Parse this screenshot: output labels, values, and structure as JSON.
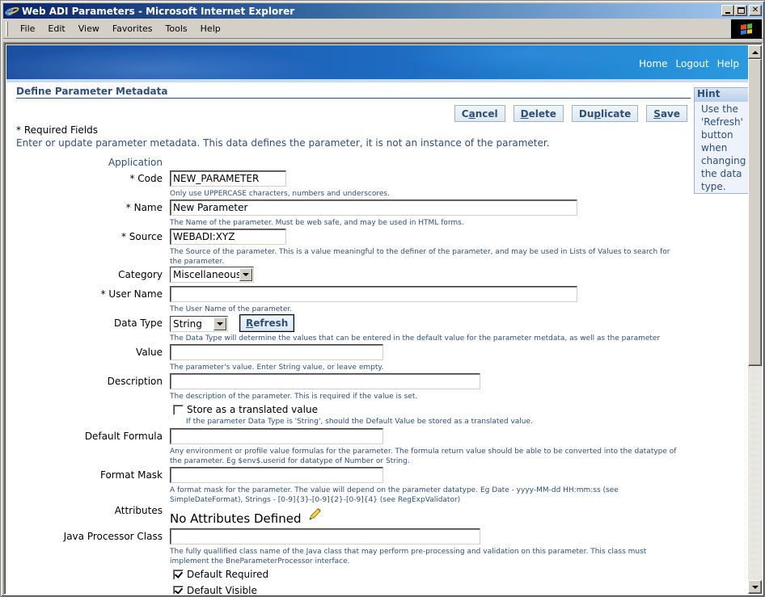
{
  "window": {
    "title": "Web ADI Parameters - Microsoft Internet Explorer",
    "controls": [
      "minimize",
      "maximize",
      "close"
    ]
  },
  "menu": {
    "items": [
      "File",
      "Edit",
      "View",
      "Favorites",
      "Tools",
      "Help"
    ]
  },
  "global_links": [
    "Home",
    "Logout",
    "Help"
  ],
  "page": {
    "title": "Define Parameter Metadata",
    "required_note": "* Required Fields",
    "intro": "Enter or update parameter metadata. This data defines the parameter, it is not an instance of the parameter."
  },
  "actions": {
    "cancel": {
      "pre": "C",
      "key": "a",
      "post": "ncel"
    },
    "delete": {
      "pre": "",
      "key": "D",
      "post": "elete"
    },
    "duplicate": {
      "pre": "Du",
      "key": "p",
      "post": "licate"
    },
    "save": {
      "pre": "",
      "key": "S",
      "post": "ave"
    }
  },
  "hint": {
    "title": "Hint",
    "body": "Use the 'Refresh' button when changing the data type."
  },
  "form": {
    "application_label": "Application",
    "code": {
      "label": "* Code",
      "value": "NEW_PARAMETER",
      "help": "Only use UPPERCASE characters, numbers and underscores."
    },
    "name": {
      "label": "* Name",
      "value": "New Parameter",
      "help": "The Name of the parameter. Must be web safe, and may be used in HTML forms."
    },
    "source": {
      "label": "* Source",
      "value": "WEBADI:XYZ",
      "help": "The Source of the parameter. This is a value meaningful to the definer of the parameter, and may be used in Lists of Values to search for the parameter."
    },
    "category": {
      "label": "Category",
      "value": "Miscellaneous"
    },
    "user_name": {
      "label": "* User Name",
      "value": "",
      "help": "The User Name of the parameter."
    },
    "data_type": {
      "label": "Data Type",
      "value": "String",
      "refresh_key": "R",
      "refresh_rest": "efresh",
      "help": "The Data Type will determine the values that can be entered in the default value for the parameter metdata, as well as the parameter instance."
    },
    "value": {
      "label": "Value",
      "value": "",
      "help": "The parameter's value. Enter String value, or leave empty."
    },
    "description": {
      "label": "Description",
      "value": "",
      "help": "The description of the parameter. This is required if the value is set."
    },
    "store_translated": {
      "label": "Store as a translated value",
      "checked": false,
      "help": "If the parameter Data Type is 'String', should the Default Value be stored as a translated value."
    },
    "default_formula": {
      "label": "Default Formula",
      "value": "",
      "help": "Any environment or profile value formulas for the parameter. The formula return value should be able to be converted into the datatype of the parameter. Eg $env$.userid for datatype of Number or String."
    },
    "format_mask": {
      "label": "Format Mask",
      "value": "",
      "help": "A format mask for the parameter. The value will depend on the parameter datatype. Eg Date - yyyy-MM-dd HH:mm:ss (see SimpleDateFormat), Strings - [0-9]{3}-[0-9]{2}-[0-9]{4} (see RegExpValidator)"
    },
    "attributes": {
      "label": "Attributes",
      "value": "No Attributes Defined"
    },
    "java_processor_class": {
      "label": "Java Processor Class",
      "value": "",
      "help": "The fully quallified class name of the Java class that may perform pre-processing and validation on this parameter. This class must implement the BneParameterProcessor interface."
    },
    "default_required": {
      "label": "Default Required",
      "checked": true
    },
    "default_visible": {
      "label": "Default Visible",
      "checked": true
    }
  },
  "colors": {
    "accent": "#2e4f7a",
    "banner": "#1d6cc4",
    "hint_bg": "#eef2fb"
  }
}
